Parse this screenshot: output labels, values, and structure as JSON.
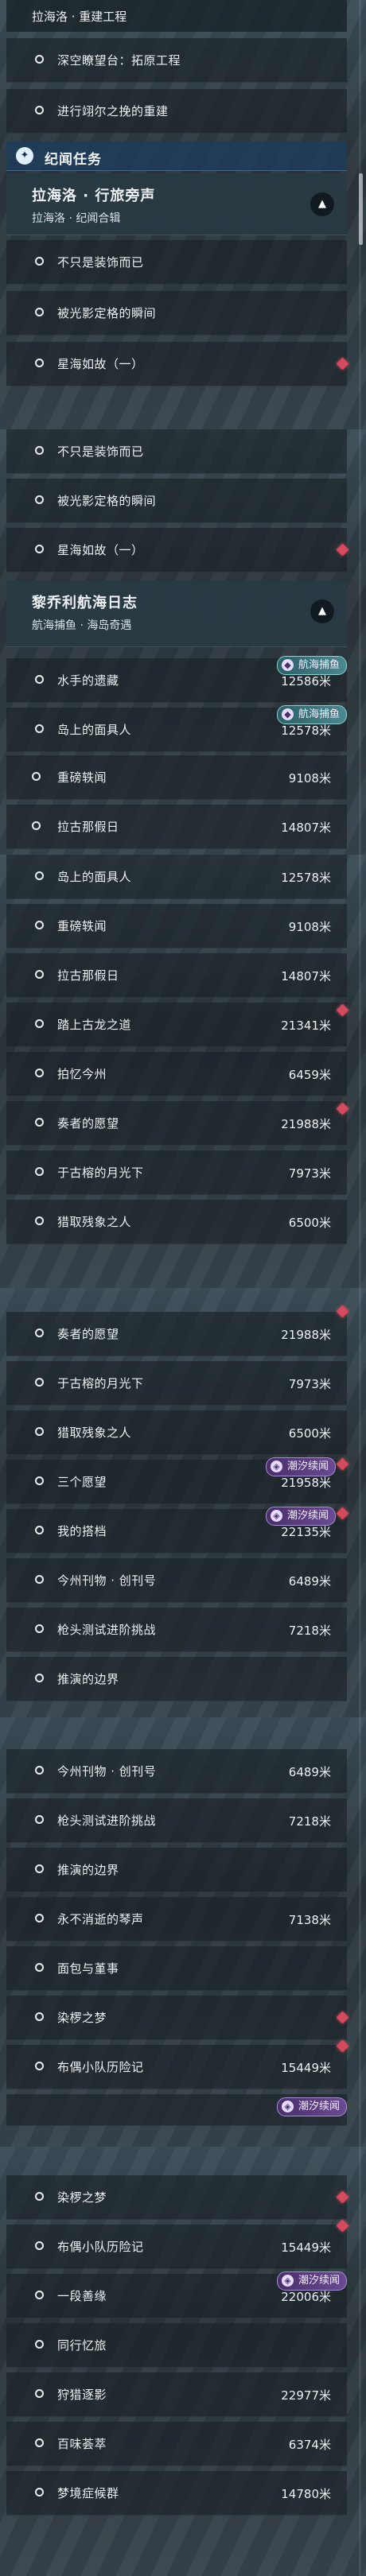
{
  "unit": "米",
  "shot1": {
    "top_item": "拉海洛 · 重建工程",
    "items_a": [
      "深空瞭望台：拓原工程",
      "进行翊尔之挽的重建"
    ],
    "section_label": "纪闻任务",
    "header": {
      "title": "拉海洛 · 行旅旁声",
      "subtitle": "拉海洛 · 纪闻合辑"
    },
    "items_b": [
      "不只是装饰而已",
      "被光影定格的瞬间",
      "星海如故（一）"
    ]
  },
  "shot2": {
    "items": [
      "不只是装饰而已",
      "被光影定格的瞬间",
      "星海如故（一）"
    ],
    "header": {
      "title": "黎乔利航海日志",
      "subtitle": "航海捕鱼 · 海岛奇遇"
    },
    "rows": [
      {
        "name": "水手的遗藏",
        "dist": "12586",
        "badge": "航海捕鱼"
      },
      {
        "name": "岛上的面具人",
        "dist": "12578",
        "badge": "航海捕鱼"
      },
      {
        "name": "重磅轶闻",
        "dist": "9108"
      },
      {
        "name": "拉古那假日",
        "dist": "14807"
      }
    ]
  },
  "shot3": {
    "rows": [
      {
        "name": "岛上的面具人",
        "dist": "12578"
      },
      {
        "name": "重磅轶闻",
        "dist": "9108"
      },
      {
        "name": "拉古那假日",
        "dist": "14807"
      },
      {
        "name": "踏上古龙之道",
        "dist": "21341"
      },
      {
        "name": "拍忆今州",
        "dist": "6459"
      },
      {
        "name": "奏者的愿望",
        "dist": "21988"
      },
      {
        "name": "于古榕的月光下",
        "dist": "7973"
      },
      {
        "name": "猎取残象之人",
        "dist": "6500"
      }
    ]
  },
  "shot4": {
    "rows": [
      {
        "name": "奏者的愿望",
        "dist": "21988"
      },
      {
        "name": "于古榕的月光下",
        "dist": "7973"
      },
      {
        "name": "猎取残象之人",
        "dist": "6500"
      },
      {
        "name": "三个愿望",
        "dist": "21958",
        "badge": "潮汐续闻"
      },
      {
        "name": "我的搭档",
        "dist": "22135",
        "badge": "潮汐续闻"
      },
      {
        "name": "今州刊物 · 创刊号",
        "dist": "6489"
      },
      {
        "name": "枪头测试进阶挑战",
        "dist": "7218"
      },
      {
        "name": "推演的边界",
        "dist": ""
      }
    ]
  },
  "shot5": {
    "rows": [
      {
        "name": "今州刊物 · 创刊号",
        "dist": "6489"
      },
      {
        "name": "枪头测试进阶挑战",
        "dist": "7218"
      },
      {
        "name": "推演的边界",
        "dist": ""
      },
      {
        "name": "永不消逝的琴声",
        "dist": "7138"
      },
      {
        "name": "面包与堇事",
        "dist": ""
      },
      {
        "name": "染椤之梦",
        "dist": ""
      },
      {
        "name": "布偶小队历险记",
        "dist": "15449"
      }
    ],
    "badge_tail": "潮汐续闻"
  },
  "shot6": {
    "rows": [
      {
        "name": "染椤之梦",
        "dist": ""
      },
      {
        "name": "布偶小队历险记",
        "dist": "15449"
      },
      {
        "name": "一段善缘",
        "dist": "22006",
        "badge": "潮汐续闻"
      },
      {
        "name": "同行忆旅",
        "dist": ""
      },
      {
        "name": "狩猎逐影",
        "dist": "22977"
      },
      {
        "name": "百味荟萃",
        "dist": "6374"
      },
      {
        "name": "梦境症候群",
        "dist": "14780"
      }
    ]
  }
}
